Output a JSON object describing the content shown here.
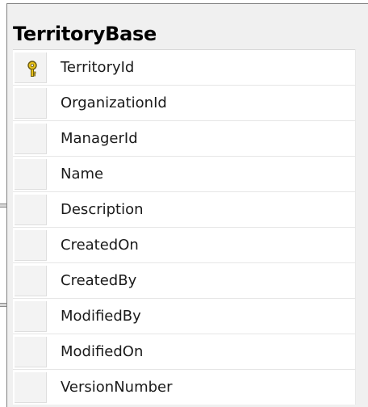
{
  "table": {
    "title": "TerritoryBase",
    "columns": [
      {
        "name": "TerritoryId",
        "primary_key": true
      },
      {
        "name": "OrganizationId",
        "primary_key": false
      },
      {
        "name": "ManagerId",
        "primary_key": false
      },
      {
        "name": "Name",
        "primary_key": false
      },
      {
        "name": "Description",
        "primary_key": false
      },
      {
        "name": "CreatedOn",
        "primary_key": false
      },
      {
        "name": "CreatedBy",
        "primary_key": false
      },
      {
        "name": "ModifiedBy",
        "primary_key": false
      },
      {
        "name": "ModifiedOn",
        "primary_key": false
      },
      {
        "name": "VersionNumber",
        "primary_key": false
      }
    ],
    "key_icon": "primary-key-icon"
  },
  "colors": {
    "key_gold": "#e8c21a",
    "key_outline": "#6b5a10",
    "header_bg": "#f0f0f0",
    "grid_bg": "#ffffff"
  }
}
